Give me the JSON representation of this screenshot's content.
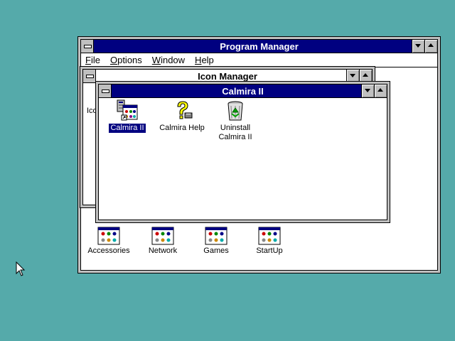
{
  "program_manager": {
    "title": "Program Manager",
    "menu": [
      {
        "label": "File",
        "mnemonic": "F",
        "rest": "ile"
      },
      {
        "label": "Options",
        "mnemonic": "O",
        "rest": "ptions"
      },
      {
        "label": "Window",
        "mnemonic": "W",
        "rest": "indow"
      },
      {
        "label": "Help",
        "mnemonic": "H",
        "rest": "elp"
      }
    ],
    "group_icons": [
      {
        "label": "Accessories",
        "icon": "program-group-icon"
      },
      {
        "label": "Network",
        "icon": "program-group-icon"
      },
      {
        "label": "Games",
        "icon": "program-group-icon"
      },
      {
        "label": "StartUp",
        "icon": "program-group-icon"
      }
    ]
  },
  "icon_manager": {
    "title": "Icon Manager",
    "partial_icon_label": "Ico"
  },
  "calmira": {
    "title": "Calmira II",
    "items": [
      {
        "label": "Calmira II",
        "icon": "calmira-app-icon",
        "selected": true
      },
      {
        "label": "Calmira Help",
        "icon": "help-question-icon",
        "selected": false
      },
      {
        "label_line1": "Uninstall",
        "label_line2": "Calmira II",
        "icon": "recycle-bin-icon",
        "selected": false
      }
    ]
  },
  "colors": {
    "desktop": "#55aaaa",
    "active_title": "#000080",
    "window_face": "#c0c0c0"
  }
}
